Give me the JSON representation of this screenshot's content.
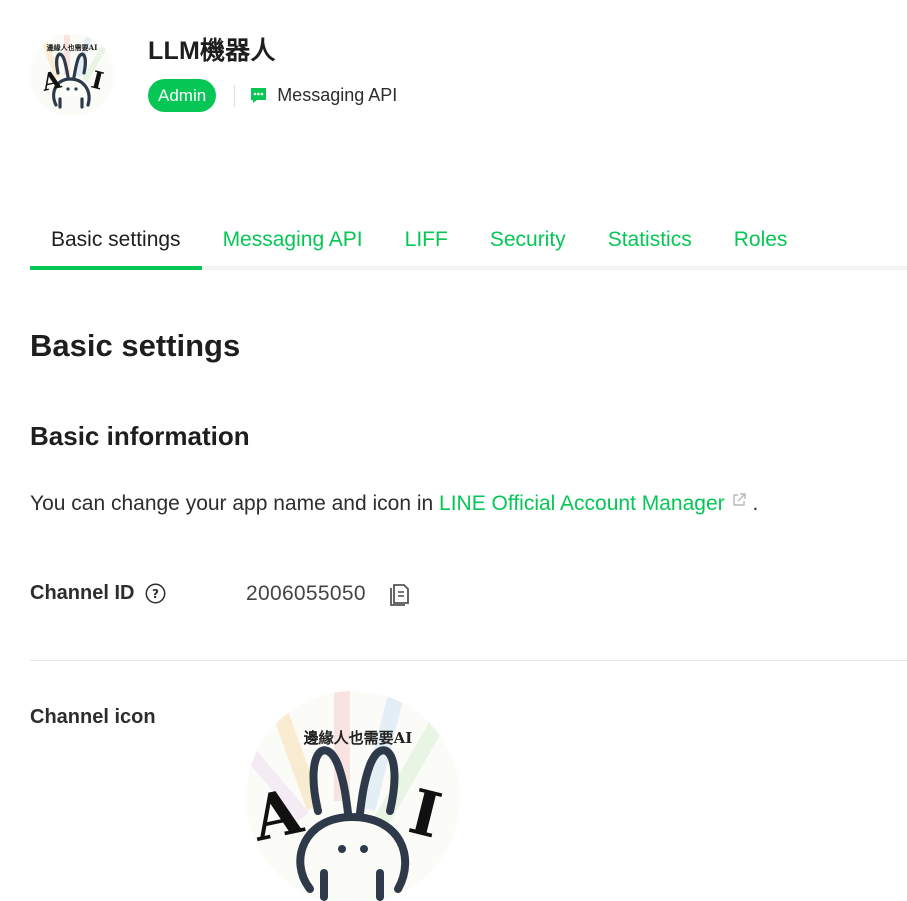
{
  "header": {
    "app_name": "LLM機器人",
    "role_badge": "Admin",
    "channel_type": "Messaging API",
    "avatar_caption": "邊緣人也需要AI",
    "avatar_letters": [
      "A",
      "I"
    ]
  },
  "tabs": [
    {
      "label": "Basic settings",
      "active": true
    },
    {
      "label": "Messaging API",
      "active": false
    },
    {
      "label": "LIFF",
      "active": false
    },
    {
      "label": "Security",
      "active": false
    },
    {
      "label": "Statistics",
      "active": false
    },
    {
      "label": "Roles",
      "active": false
    }
  ],
  "main": {
    "page_title": "Basic settings",
    "section_title": "Basic information",
    "info_text_before": "You can change your app name and icon in ",
    "info_link": "LINE Official Account Manager",
    "info_text_after": " .",
    "channel_id_label": "Channel ID",
    "channel_id_value": "2006055050",
    "channel_icon_label": "Channel icon",
    "icon_caption": "邊緣人也需要AI",
    "icon_letters": [
      "A",
      "I"
    ]
  },
  "colors": {
    "accent": "#06c755",
    "text": "#1e1e1e",
    "rabbit": "#2e3a4a"
  },
  "icons": {
    "channel_type": "chat-bubble-icon",
    "external": "external-link-icon",
    "help": "question-circle-icon",
    "copy": "copy-icon"
  }
}
